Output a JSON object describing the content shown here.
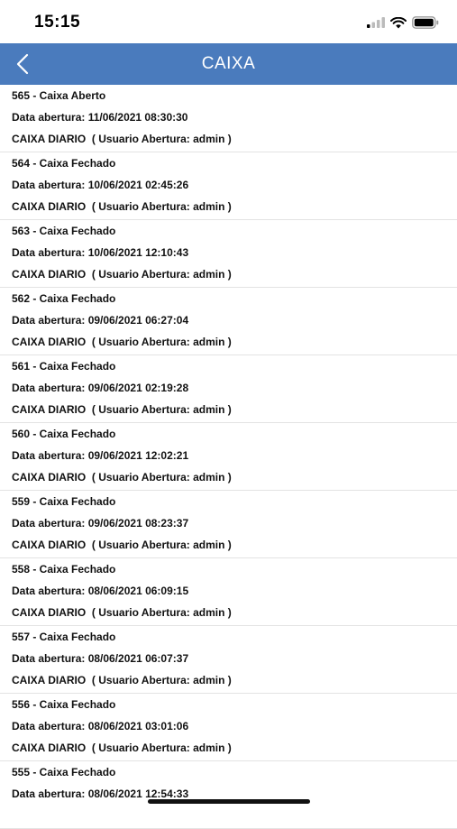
{
  "status_bar": {
    "time": "15:15",
    "icons": [
      "signal-icon",
      "wifi-icon",
      "battery-icon"
    ]
  },
  "nav": {
    "title": "CAIXA",
    "back_icon": "chevron-left-icon",
    "bar_color": "#4a7bbd"
  },
  "items": [
    {
      "title": "565 - Caixa Aberto",
      "opened": "Data abertura: 11/06/2021 08:30:30",
      "detail": "CAIXA DIARIO  ( Usuario Abertura: admin )"
    },
    {
      "title": "564 - Caixa Fechado",
      "opened": "Data abertura: 10/06/2021 02:45:26",
      "detail": "CAIXA DIARIO  ( Usuario Abertura: admin )"
    },
    {
      "title": "563 - Caixa Fechado",
      "opened": "Data abertura: 10/06/2021 12:10:43",
      "detail": "CAIXA DIARIO  ( Usuario Abertura: admin )"
    },
    {
      "title": "562 - Caixa Fechado",
      "opened": "Data abertura: 09/06/2021 06:27:04",
      "detail": "CAIXA DIARIO  ( Usuario Abertura: admin )"
    },
    {
      "title": "561 - Caixa Fechado",
      "opened": "Data abertura: 09/06/2021 02:19:28",
      "detail": "CAIXA DIARIO  ( Usuario Abertura: admin )"
    },
    {
      "title": "560 - Caixa Fechado",
      "opened": "Data abertura: 09/06/2021 12:02:21",
      "detail": "CAIXA DIARIO  ( Usuario Abertura: admin )"
    },
    {
      "title": "559 - Caixa Fechado",
      "opened": "Data abertura: 09/06/2021 08:23:37",
      "detail": "CAIXA DIARIO  ( Usuario Abertura: admin )"
    },
    {
      "title": "558 - Caixa Fechado",
      "opened": "Data abertura: 08/06/2021 06:09:15",
      "detail": "CAIXA DIARIO  ( Usuario Abertura: admin )"
    },
    {
      "title": "557 - Caixa Fechado",
      "opened": "Data abertura: 08/06/2021 06:07:37",
      "detail": "CAIXA DIARIO  ( Usuario Abertura: admin )"
    },
    {
      "title": "556 - Caixa Fechado",
      "opened": "Data abertura: 08/06/2021 03:01:06",
      "detail": "CAIXA DIARIO  ( Usuario Abertura: admin )"
    },
    {
      "title": "555 - Caixa Fechado",
      "opened": "Data abertura: 08/06/2021 12:54:33",
      "detail": ""
    }
  ]
}
